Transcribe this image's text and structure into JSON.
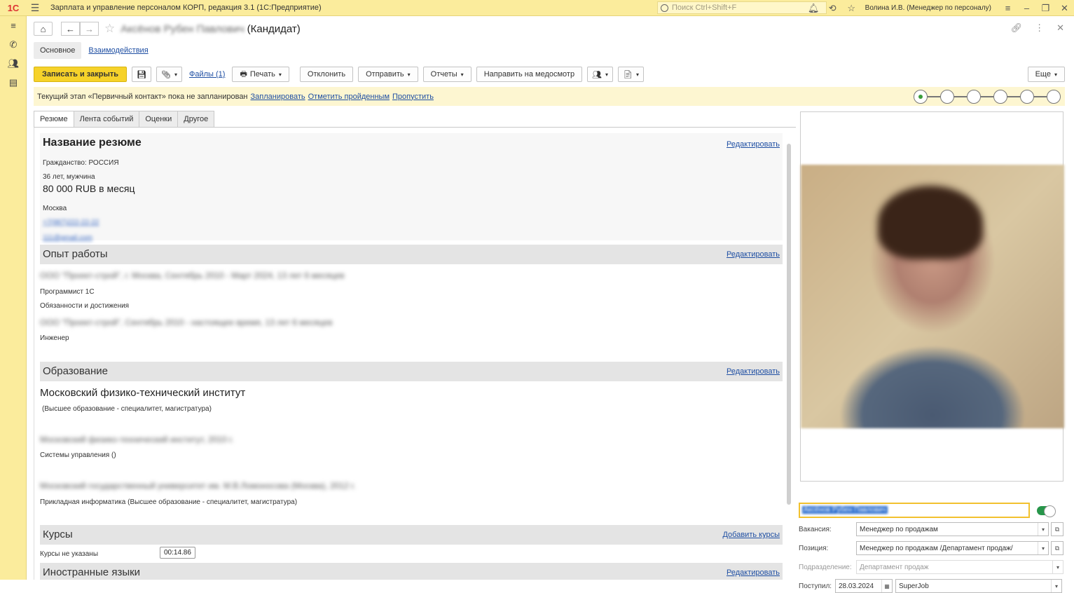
{
  "titlebar": {
    "logo": "1С",
    "title": "Зарплата и управление персоналом КОРП, редакция 3.1  (1С:Предприятие)",
    "search_placeholder": "Поиск Ctrl+Shift+F",
    "user": "Волина И.В. (Менеджер по персоналу)",
    "icons": [
      "bell-icon",
      "history-icon",
      "star-icon",
      "menu-icon",
      "minimize-icon",
      "restore-icon",
      "close-icon"
    ]
  },
  "sidebar": {
    "icons": [
      "menu-icon",
      "phone-icon",
      "people-icon",
      "card-icon"
    ]
  },
  "form": {
    "candidate_name": "Аксёнов Рубен Павлович",
    "title_suffix": "(Кандидат)",
    "subtabs": {
      "main": "Основное",
      "interactions": "Взаимодействия"
    }
  },
  "toolbar": {
    "save_close": "Записать и закрыть",
    "files": "Файлы (1)",
    "print": "Печать",
    "reject": "Отклонить",
    "send": "Отправить",
    "reports": "Отчеты",
    "medical": "Направить на медосмотр",
    "more": "Еще"
  },
  "stage": {
    "text": "Текущий этап «Первичный контакт» пока не запланирован",
    "plan": "Запланировать",
    "mark_done": "Отметить пройденным",
    "skip": "Пропустить",
    "count": 6,
    "active_index": 0
  },
  "tabs": [
    "Резюме",
    "Лента событий",
    "Оценки",
    "Другое"
  ],
  "resume": {
    "title": "Название резюме",
    "citizenship": "Гражданство: РОССИЯ",
    "age_gender": "36 лет, мужчина",
    "salary": "80 000 RUB в месяц",
    "city": "Москва",
    "phone": "+7(987)222-22-22",
    "email": "111@gmail.com",
    "edit": "Редактировать"
  },
  "experience": {
    "title": "Опыт работы",
    "edit": "Редактировать",
    "job1": "ООО \"Проект-строй\", г. Москва, Сентябрь 2010 - Март 2024, 13 лет 6 месяцев",
    "job1_role": "Программист 1С",
    "job1_duties": "Обязанности и достижения",
    "job2": "ООО \"Проект-строй\", Сентябрь 2010 - настоящее время, 13 лет 6 месяцев",
    "job2_role": "Инженер"
  },
  "education": {
    "title": "Образование",
    "edit": "Редактировать",
    "institute": "Московский физико-технический институт",
    "institute_level": "(Высшее образование - специалитет, магистратура)",
    "edu1": "Московский физико-технический институт, 2010 г.",
    "edu1_spec": "Системы управления ()",
    "edu2": "Московский государственный университет им. М.В.Ломоносова (Москва), 2012 г.",
    "edu2_spec": "Прикладная информатика (Высшее образование - специалитет, магистратура)"
  },
  "courses": {
    "title": "Курсы",
    "add": "Добавить курсы",
    "none": "Курсы не указаны"
  },
  "languages": {
    "title": "Иностранные языки",
    "edit": "Редактировать"
  },
  "right_panel": {
    "name_value": "Аксёнов Рубен Павлович",
    "vacancy_label": "Вакансия:",
    "vacancy_value": "Менеджер  по продажам",
    "position_label": "Позиция:",
    "position_value": "Менеджер по продажам /Департамент продаж/",
    "department_label": "Подразделение:",
    "department_value": "Департамент продаж",
    "received_label": "Поступил:",
    "received_date": "28.03.2024",
    "source_value": "SuperJob"
  },
  "timer": "00:14.86"
}
